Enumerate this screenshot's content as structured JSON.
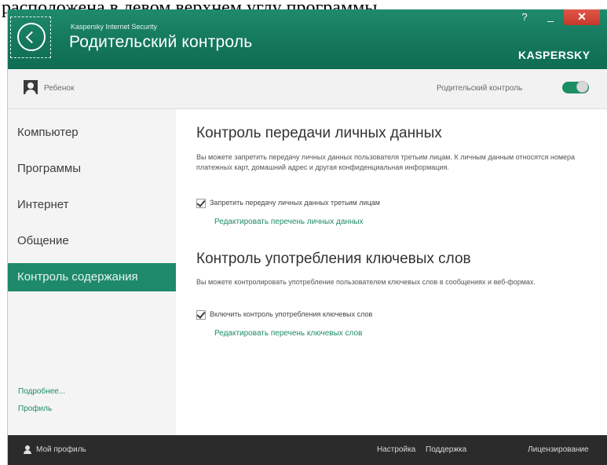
{
  "caption": "расположена в левом верхнем углу программы.",
  "window": {
    "app_name": "Kaspersky Internet Security",
    "section_title": "Родительский контроль",
    "brand": "KASPERSKY",
    "controls": {
      "help": "?",
      "minimize": "_",
      "close": "✕"
    }
  },
  "profile_bar": {
    "child_label": "Ребенок",
    "parental_control_label": "Родительский контроль",
    "toggle_on": true
  },
  "sidebar": {
    "items": [
      {
        "label": "Компьютер",
        "active": false
      },
      {
        "label": "Программы",
        "active": false
      },
      {
        "label": "Интернет",
        "active": false
      },
      {
        "label": "Общение",
        "active": false
      },
      {
        "label": "Контроль содержания",
        "active": true
      }
    ],
    "more_link": "Подробнее...",
    "profile_link": "Профиль"
  },
  "content": {
    "section1": {
      "title": "Контроль передачи личных данных",
      "description": "Вы можете запретить передачу личных данных пользователя третьим лицам. К личным данным относятся номера платежных карт, домашний адрес и другая конфиденциальная информация.",
      "checkbox_label": "Запретить передачу личных данных третьим лицам",
      "checked": true,
      "edit_link": "Редактировать перечень личных данных"
    },
    "section2": {
      "title": "Контроль употребления ключевых слов",
      "description": "Вы можете контролировать употребление пользователем ключевых слов в сообщениях и веб-формах.",
      "checkbox_label": "Включить контроль употребления ключевых слов",
      "checked": true,
      "edit_link": "Редактировать перечень ключевых слов"
    }
  },
  "footer": {
    "my_profile": "Мой профиль",
    "settings": "Настройка",
    "support": "Поддержка",
    "licensing": "Лицензирование"
  },
  "colors": {
    "accent": "#1e8a6b",
    "titlebar": "#13765b",
    "footer": "#2b2b2b",
    "close_button": "#d04636"
  }
}
